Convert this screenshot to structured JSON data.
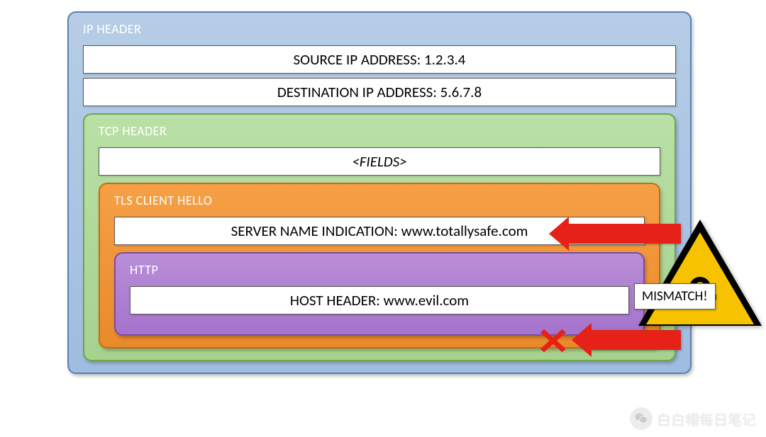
{
  "ip": {
    "title": "IP HEADER",
    "source_label": "SOURCE IP ADDRESS: 1.2.3.4",
    "dest_label": "DESTINATION IP ADDRESS: 5.6.7.8"
  },
  "tcp": {
    "title": "TCP HEADER",
    "fields_label": "<FIELDS>"
  },
  "tls": {
    "title": "TLS CLIENT HELLO",
    "sni_label": "SERVER NAME INDICATION: www.totallysafe.com"
  },
  "http": {
    "title": "HTTP",
    "host_label": "HOST HEADER: www.evil.com"
  },
  "alert": {
    "mismatch_label": "MISMATCH!",
    "x_symbol": "✕",
    "hazard_icon": "biohazard-icon"
  },
  "watermark": {
    "text": "白白帽每日笔记",
    "icon": "wechat-icon"
  }
}
